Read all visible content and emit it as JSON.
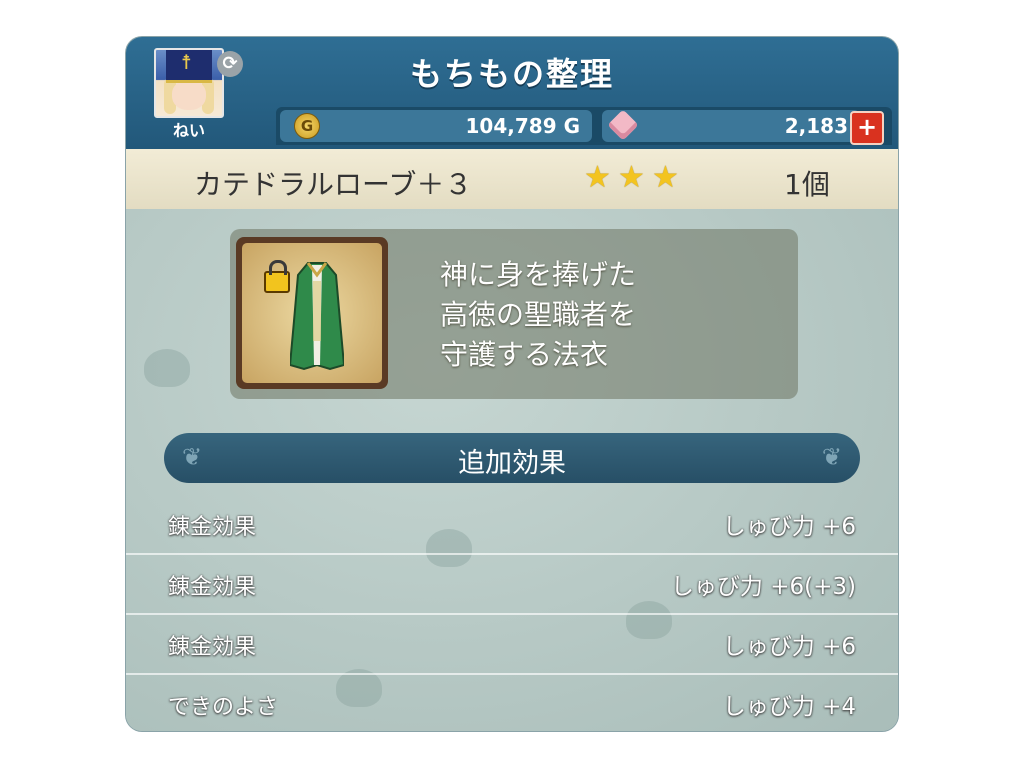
{
  "header": {
    "title": "もちもの整理",
    "player_name": "ねい"
  },
  "currency": {
    "gold": "104,789 G",
    "gems": "2,183",
    "plus_label": "+"
  },
  "item": {
    "name": "カテドラルローブ＋３",
    "stars": [
      "★",
      "★",
      "★"
    ],
    "count": "1個",
    "description": "神に身を捧げた\n高徳の聖職者を\n守護する法衣"
  },
  "effects": {
    "title": "追加効果",
    "rows": [
      {
        "label": "錬金効果",
        "value": "しゅび力 +6"
      },
      {
        "label": "錬金効果",
        "value": "しゅび力 +6(+3)"
      },
      {
        "label": "錬金効果",
        "value": "しゅび力 +6"
      },
      {
        "label": "できのよさ",
        "value": "しゅび力 +4"
      }
    ]
  },
  "colors": {
    "header": "#2f6e94",
    "star": "#f3c420",
    "plus_button": "#d9321f"
  }
}
